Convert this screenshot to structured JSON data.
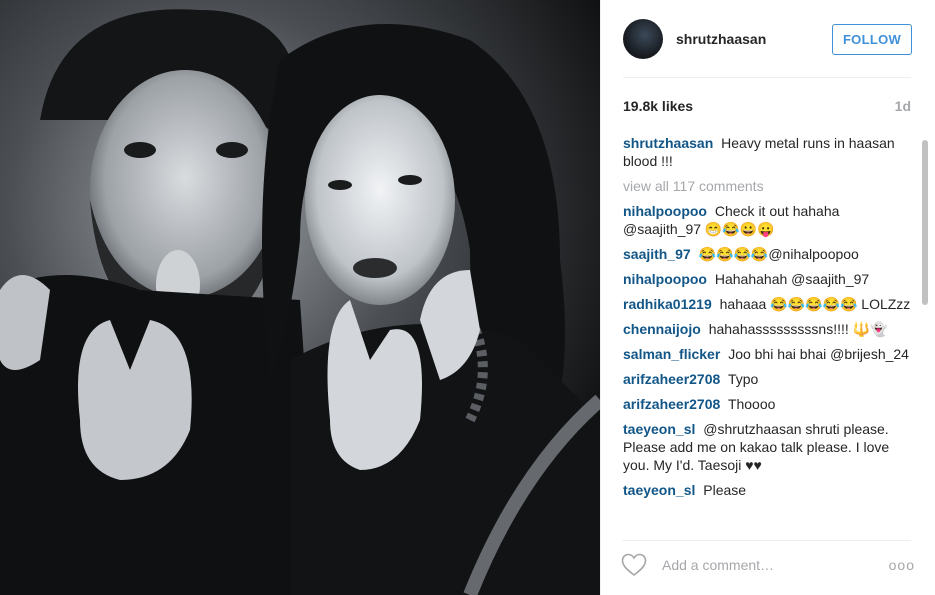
{
  "post": {
    "username": "shrutzhaasan",
    "follow_label": "FOLLOW",
    "likes": "19.8k likes",
    "time": "1d",
    "caption": {
      "user": "shrutzhaasan",
      "text": "Heavy metal runs in haasan blood !!!"
    },
    "view_all": "view all 117 comments"
  },
  "comments": [
    {
      "user": "nihalpoopoo",
      "text": "Check it out hahaha @saajith_97 😁😂😀😛"
    },
    {
      "user": "saajith_97",
      "text": "😂😂😂😂@nihalpoopoo"
    },
    {
      "user": "nihalpoopoo",
      "text": "Hahahahah @saajith_97"
    },
    {
      "user": "radhika01219",
      "text": "hahaaa 😂😂😂😂😂 LOLZzz"
    },
    {
      "user": "chennaijojo",
      "text": "hahahasssssssssns!!!! 🔱👻"
    },
    {
      "user": "salman_flicker",
      "text": "Joo bhi hai bhai @brijesh_24"
    },
    {
      "user": "arifzaheer2708",
      "text": "Typo"
    },
    {
      "user": "arifzaheer2708",
      "text": "Thoooo"
    },
    {
      "user": "taeyeon_sl",
      "text": "@shrutzhaasan shruti please. Please add me on kakao talk please. I love you. My I'd. Taesoji ♥♥"
    },
    {
      "user": "taeyeon_sl",
      "text": "Please"
    }
  ],
  "footer": {
    "placeholder": "Add a comment…",
    "more": "ooo"
  },
  "icons": {
    "like": "heart-icon",
    "options": "more-options-icon"
  },
  "colors": {
    "link": "#125688",
    "follow": "#3f91d8",
    "muted": "#a5a7aa"
  }
}
